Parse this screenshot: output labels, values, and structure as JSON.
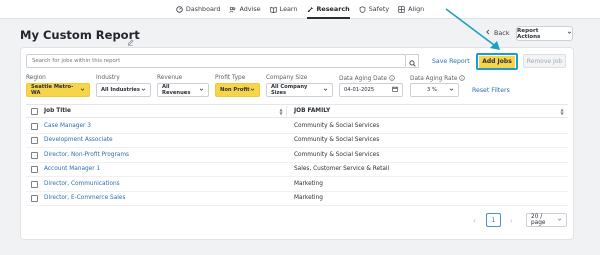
{
  "nav": {
    "items": [
      {
        "label": "Dashboard",
        "icon": "dashboard-icon",
        "active": false
      },
      {
        "label": "Advise",
        "icon": "people-icon",
        "active": false
      },
      {
        "label": "Learn",
        "icon": "book-icon",
        "active": false
      },
      {
        "label": "Research",
        "icon": "flask-icon",
        "active": true
      },
      {
        "label": "Safety",
        "icon": "shield-icon",
        "active": false
      },
      {
        "label": "Align",
        "icon": "grid-icon",
        "active": false
      }
    ]
  },
  "header": {
    "title": "My Custom Report",
    "back_label": "Back",
    "actions_label": "Report Actions"
  },
  "toolbar": {
    "search_placeholder": "Search for jobs within this report",
    "save_report": "Save Report",
    "add_jobs": "Add Jobs",
    "remove_job": "Remove Job"
  },
  "filters": {
    "region": {
      "label": "Region",
      "value": "Seattle Metro-WA"
    },
    "industry": {
      "label": "Industry",
      "value": "All Industries"
    },
    "revenue": {
      "label": "Revenue",
      "value": "All Revenues"
    },
    "profit_type": {
      "label": "Profit Type",
      "value": "Non Profit"
    },
    "company_size": {
      "label": "Company Size",
      "value": "All Company Sizes"
    },
    "aging_date": {
      "label": "Data Aging Date",
      "value": "04-01-2025"
    },
    "aging_rate": {
      "label": "Data Aging Rate",
      "value": "3 %"
    },
    "reset": "Reset Filters"
  },
  "table": {
    "columns": [
      "Job Title",
      "JOB FAMILY"
    ],
    "rows": [
      {
        "title": "Case Manager 3",
        "family": "Community & Social Services"
      },
      {
        "title": "Development Associate",
        "family": "Community & Social Services"
      },
      {
        "title": "Director, Non-Profit Programs",
        "family": "Community & Social Services"
      },
      {
        "title": "Account Manager 1",
        "family": "Sales, Customer Service & Retail"
      },
      {
        "title": "Director, Communications",
        "family": "Marketing"
      },
      {
        "title": "Director, E-Commerce Sales",
        "family": "Marketing"
      }
    ]
  },
  "pagination": {
    "current_page": "1",
    "per_page": "20 / page"
  },
  "colors": {
    "accent_yellow": "#f7d54a",
    "highlight_blue": "#1a9fc9",
    "link_blue": "#2a6eb2"
  }
}
